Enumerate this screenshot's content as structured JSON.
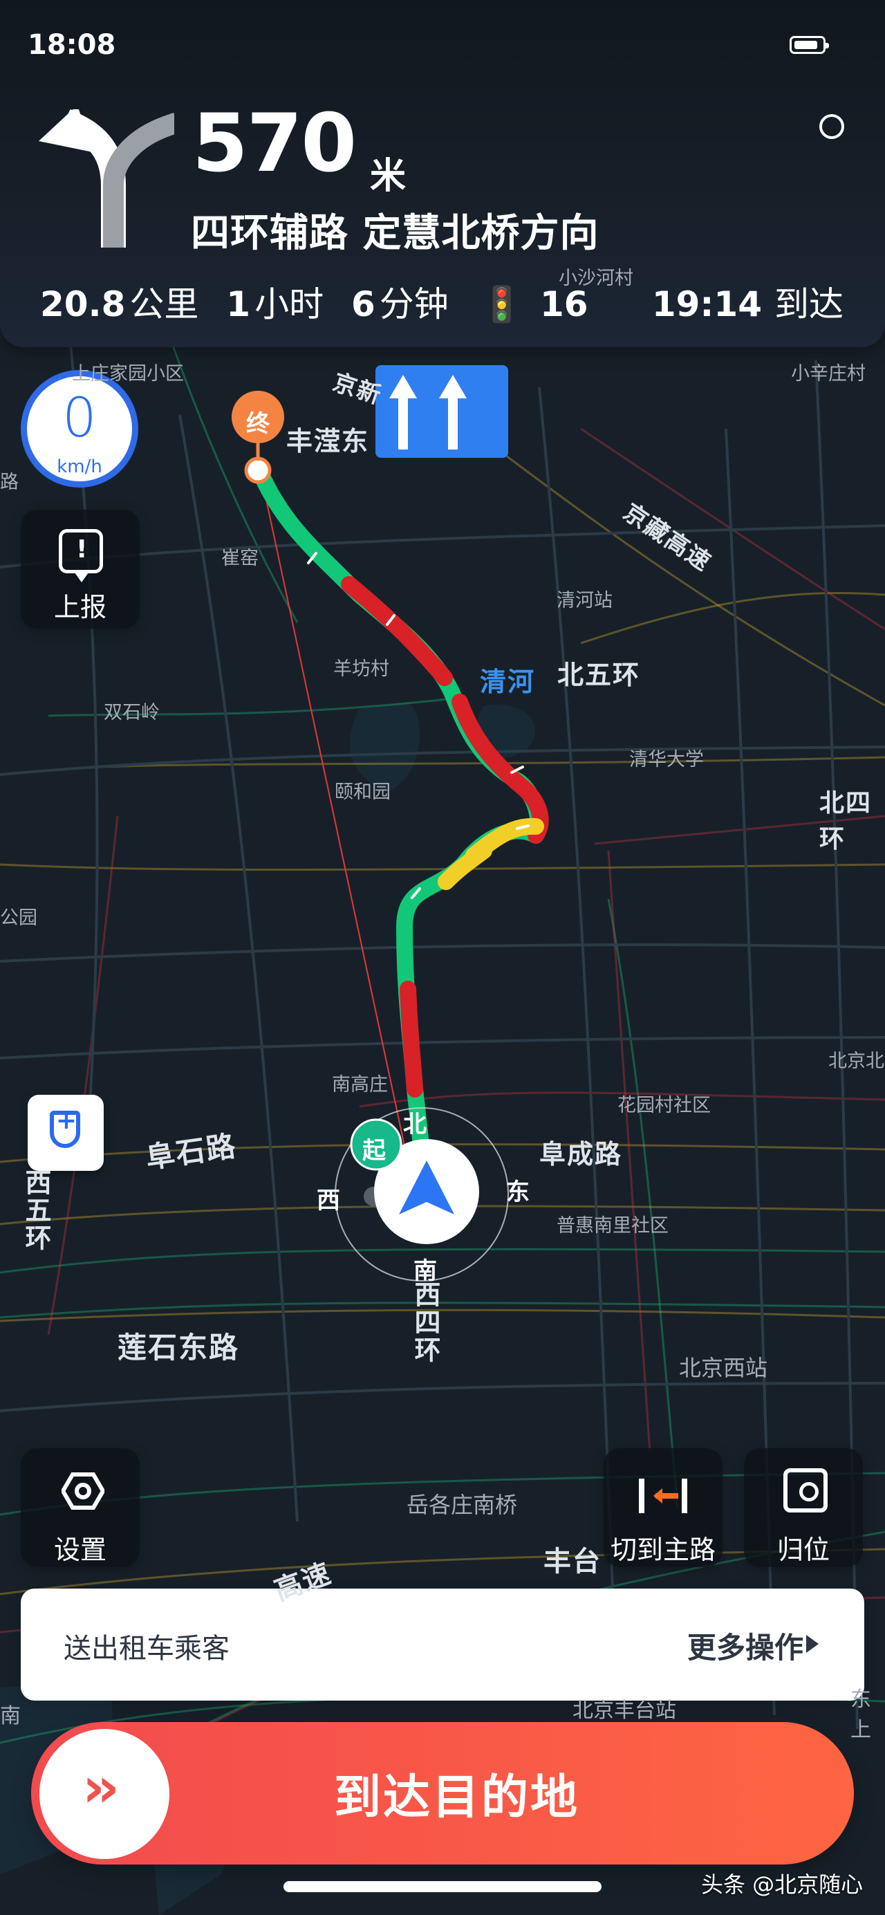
{
  "status": {
    "time": "18:08",
    "battery_level": 0.88
  },
  "navigation": {
    "distance": "570",
    "unit": "米",
    "road": "四环辅路 定慧北桥方向",
    "trip_distance_value": "20.8",
    "trip_distance_unit": "公里",
    "trip_hours": "1",
    "trip_hours_unit": "小时",
    "trip_minutes": "6",
    "trip_minutes_unit": "分钟",
    "traffic_lights": "16",
    "eta_time": "19:14",
    "eta_label": "到达"
  },
  "speed": {
    "value": "0",
    "unit": "km/h"
  },
  "buttons": {
    "report": "上报",
    "settings": "设置",
    "switch_main_road": "切到主路",
    "recenter": "归位"
  },
  "task_card": {
    "left": "送出租车乘客",
    "right": "更多操作"
  },
  "arrive_button": "到达目的地",
  "watermark": "头条 @北京随心",
  "markers": {
    "end": "终",
    "start": "起",
    "end_place": "丰滢东"
  },
  "compass": {
    "north": "北",
    "south": "南",
    "east": "东",
    "west": "西"
  },
  "map_labels": {
    "top_faint_1": "小沙河村",
    "top_left_community": "上庄家园小区",
    "top_right_village": "小辛庄村",
    "jingxin": "京新",
    "jingzang": "京藏高速",
    "qinghe_station": "清河站",
    "cuiyao": "崔窑",
    "lu_left": "路",
    "yangfang": "羊坊村",
    "qinghe": "清河",
    "north5": "北五环",
    "shuangshiling": "双石岭",
    "tsinghua": "清华大学",
    "north4": "北四环",
    "summer_palace": "颐和园",
    "park_left": "公园",
    "nangaozhuang": "南高庄",
    "huayuancun": "花园村社区",
    "beijing_north_right": "北京北",
    "fushi_road": "阜石路",
    "west5": "西五环",
    "fucheng_road": "阜成路",
    "puhui": "普惠南里社区",
    "west4": "西四环",
    "lianshi_east": "莲石东路",
    "beijing_west": "北京西站",
    "yuegezhuang": "岳各庄南桥",
    "fengtai": "丰台",
    "highway": "高速",
    "beijing_fengtai": "北京丰台站",
    "right_edge": "东上",
    "left_south": "南"
  },
  "colors": {
    "route_green": "#12c777",
    "route_yellow": "#f2cf28",
    "route_red": "#d92128",
    "navigation_blue": "#2f7ff0",
    "arrive_red": "#f14b4e"
  },
  "icons": {
    "turn": "turn-left-icon",
    "sound": "sound-icon",
    "traffic_light": "traffic-light-icon",
    "speed": "speedometer-icon",
    "report": "report-icon",
    "lane": "lane-guidance-icon",
    "shield": "shield-icon",
    "settings": "hexagon-settings-icon",
    "main_road": "main-road-icon",
    "recenter": "recenter-icon",
    "arrive": "double-chevron-icon"
  }
}
